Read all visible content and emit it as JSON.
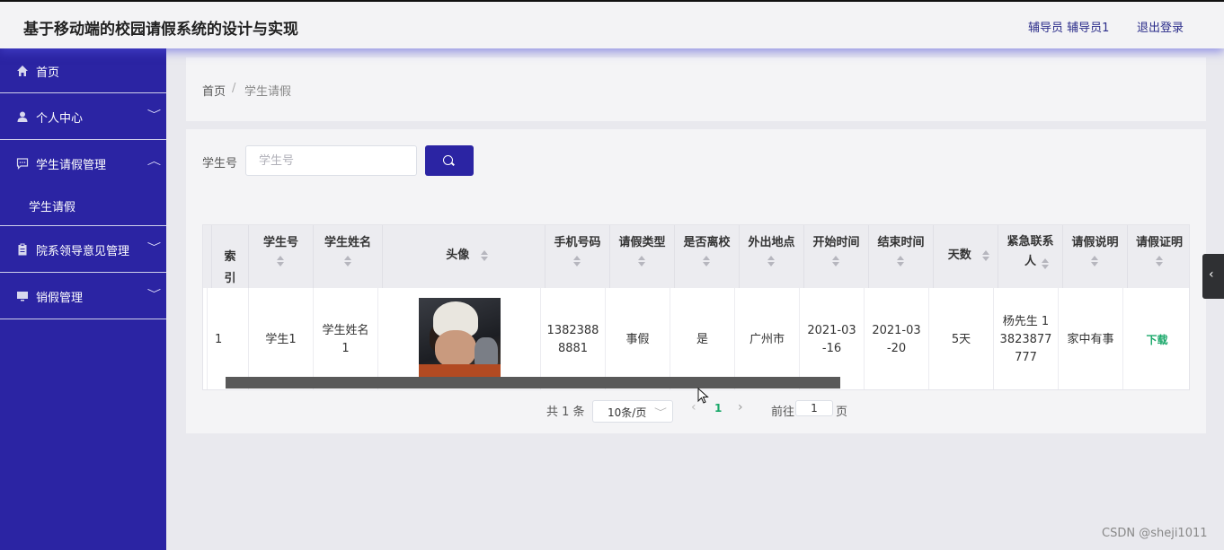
{
  "header": {
    "title": "基于移动端的校园请假系统的设计与实现",
    "user": "辅导员 辅导员1",
    "logout": "退出登录"
  },
  "sidebar": {
    "items": [
      {
        "label": "首页",
        "icon": "home-icon"
      },
      {
        "label": "个人中心",
        "icon": "user-icon"
      },
      {
        "label": "学生请假管理",
        "icon": "chat-icon"
      },
      {
        "label": "学生请假",
        "icon": ""
      },
      {
        "label": "院系领导意见管理",
        "icon": "clipboard-icon"
      },
      {
        "label": "销假管理",
        "icon": "monitor-icon"
      }
    ]
  },
  "breadcrumb": {
    "home": "首页",
    "separator": "/",
    "current": "学生请假"
  },
  "search": {
    "label": "学生号",
    "placeholder": "学生号",
    "value": ""
  },
  "table": {
    "headers": [
      "索引",
      "学生号",
      "学生姓名",
      "头像",
      "手机号码",
      "请假类型",
      "是否离校",
      "外出地点",
      "开始时间",
      "结束时间",
      "天数",
      "紧急联系人",
      "请假说明",
      "请假证明"
    ],
    "rows": [
      {
        "index": "1",
        "student_no": "学生1",
        "name": "学生姓名1",
        "phone": "13823888881",
        "leave_type": "事假",
        "left_school": "是",
        "location": "广州市",
        "start": "2021-03-16",
        "end": "2021-03-20",
        "days": "5天",
        "contact": "杨先生 13823877777",
        "reason": "家中有事",
        "proof": "下载"
      }
    ]
  },
  "pagination": {
    "total": "共 1 条",
    "page_size": "10条/页",
    "current_page": "1",
    "goto_label": "前往",
    "goto_value": "1",
    "page_unit": "页"
  },
  "watermark": "CSDN @sheji1011",
  "colors": {
    "sidebar": "#2b24a3",
    "accent": "#2b24a3",
    "link_green": "#1aa86a"
  }
}
